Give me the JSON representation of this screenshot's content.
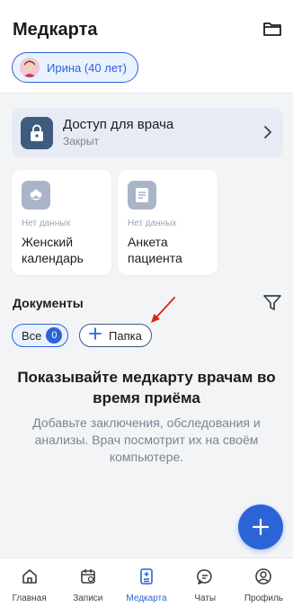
{
  "header": {
    "title": "Медкарта",
    "profile_chip": "Ирина (40 лет)"
  },
  "access": {
    "title": "Доступ для врача",
    "status": "Закрыт"
  },
  "tiles": [
    {
      "status": "Нет данных",
      "title": "Женский календарь",
      "icon": "flower-icon"
    },
    {
      "status": "Нет данных",
      "title": "Анкета пациента",
      "icon": "document-icon"
    }
  ],
  "documents": {
    "title": "Документы",
    "filter_all": "Все",
    "filter_all_count": "0",
    "folder_button": "Папка"
  },
  "empty_state": {
    "title": "Показывайте медкарту врачам во время приёма",
    "subtitle": "Добавьте заключения, обследования и анализы. Врач посмотрит их на своём компьютере."
  },
  "tabbar": [
    {
      "label": "Главная",
      "icon": "home-icon"
    },
    {
      "label": "Записи",
      "icon": "calendar-icon"
    },
    {
      "label": "Медкарта",
      "icon": "medcard-icon",
      "active": true
    },
    {
      "label": "Чаты",
      "icon": "chat-icon"
    },
    {
      "label": "Профиль",
      "icon": "profile-icon"
    }
  ],
  "colors": {
    "accent": "#2c64d8",
    "annotation_arrow": "#e0201c"
  }
}
